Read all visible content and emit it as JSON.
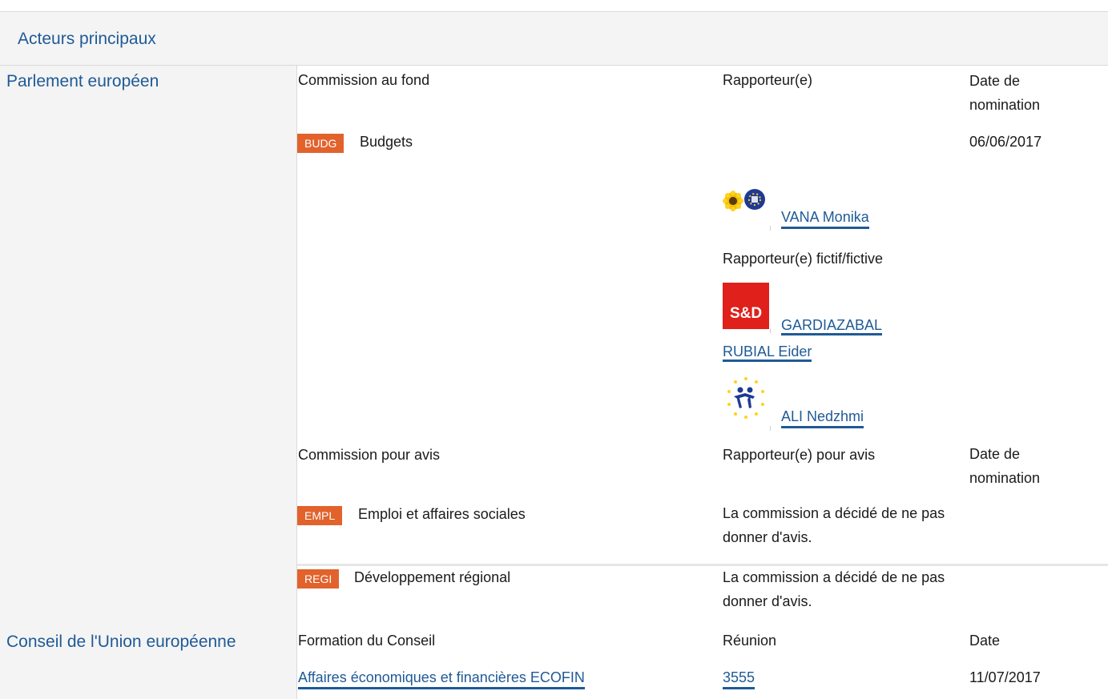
{
  "section": {
    "title": "Acteurs principaux"
  },
  "parliament": {
    "institution": "Parlement européen",
    "lead": {
      "col_committee": "Commission au fond",
      "col_rapporteur": "Rapporteur(e)",
      "col_date": "Date de nomination",
      "committee_code": "BUDG",
      "committee_name": "Budgets",
      "date": "06/06/2017",
      "rapporteur": {
        "name": "VANA Monika",
        "group_icon": "greens-efa-logo-icon"
      },
      "shadow_label": "Rapporteur(e) fictif/fictive",
      "shadows": [
        {
          "name": "GARDIAZABAL RUBIAL Eider",
          "group_icon": "s-and-d-logo-icon",
          "logo_text": "S&D"
        },
        {
          "name": "ALI Nedzhmi",
          "group_icon": "alde-logo-icon"
        }
      ]
    },
    "opinion": {
      "col_committee": "Commission pour avis",
      "col_rapporteur": "Rapporteur(e) pour avis",
      "col_date": "Date de nomination",
      "rows": [
        {
          "code": "EMPL",
          "name": "Emploi et affaires sociales",
          "note": "La commission a décidé de ne pas donner d'avis."
        },
        {
          "code": "REGI",
          "name": "Développement régional",
          "note": "La commission a décidé de ne pas donner d'avis."
        }
      ]
    }
  },
  "council": {
    "institution": "Conseil de l'Union européenne",
    "col_formation": "Formation du Conseil",
    "col_meeting": "Réunion",
    "col_date": "Date",
    "formation": "Affaires économiques et financières ECOFIN",
    "meeting": "3555",
    "date": "11/07/2017"
  },
  "colors": {
    "link": "#1f5a96",
    "badge": "#e2622c",
    "panel": "#f4f4f4"
  }
}
